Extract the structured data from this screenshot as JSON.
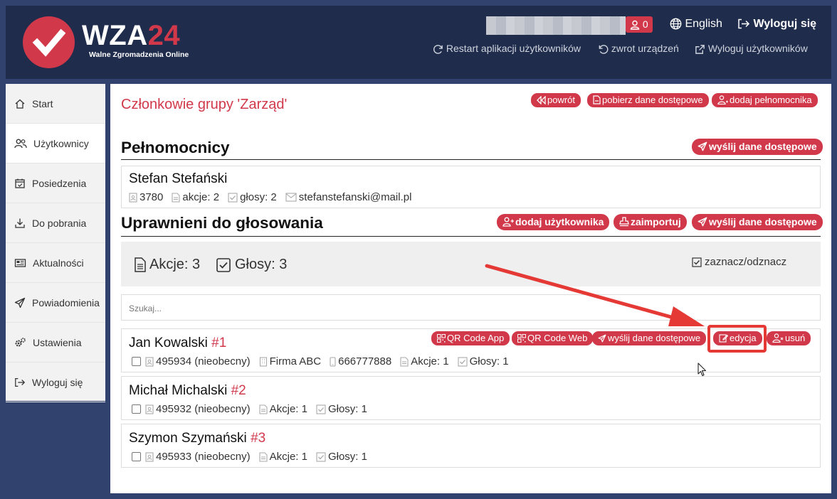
{
  "header": {
    "logo_main": "WZA",
    "logo_num": "24",
    "logo_sub": "Walne Zgromadzenia Online",
    "user_count": "0",
    "language": "English",
    "logout": "Wyloguj się",
    "restart_apps": "Restart aplikacji użytkowników",
    "return_devices": "zwrot urządzeń",
    "logout_users": "Wyloguj użytkowników"
  },
  "sidebar": {
    "items": [
      {
        "label": "Start",
        "icon": "home-icon"
      },
      {
        "label": "Użytkownicy",
        "icon": "users-icon"
      },
      {
        "label": "Posiedzenia",
        "icon": "calendar-icon"
      },
      {
        "label": "Do pobrania",
        "icon": "download-icon"
      },
      {
        "label": "Aktualności",
        "icon": "news-icon"
      },
      {
        "label": "Powiadomienia",
        "icon": "paper-plane-icon"
      },
      {
        "label": "Ustawienia",
        "icon": "gears-icon"
      },
      {
        "label": "Wyloguj się",
        "icon": "sign-out-icon"
      }
    ]
  },
  "main": {
    "title": "Członkowie grupy 'Zarząd'",
    "buttons": {
      "back": "powrót",
      "download_access": "pobierz dane dostępowe",
      "add_proxy": "dodaj pełnomocnika",
      "send_access": "wyślij dane dostępowe",
      "add_user": "dodaj użytkownika",
      "import": "zaimportuj"
    },
    "proxies_title": "Pełnomocnicy",
    "proxy": {
      "name": "Stefan Stefański",
      "id": "3780",
      "shares": "akcje: 2",
      "votes": "głosy: 2",
      "email": "stefanstefanski@mail.pl"
    },
    "voters_title": "Uprawnieni do głosowania",
    "summary": {
      "shares": "Akcje: 3",
      "votes": "Głosy: 3",
      "toggle_all": "zaznacz/odznacz"
    },
    "search_placeholder": "Szukaj...",
    "row_buttons": {
      "qr_app": "QR Code App",
      "qr_web": "QR Code Web",
      "send_access": "wyślij dane dostępowe",
      "edit": "edycja",
      "delete": "usuń"
    },
    "members": [
      {
        "name": "Jan Kowalski",
        "index": "#1",
        "id": "495934 (nieobecny)",
        "company": "Firma ABC",
        "phone": "666777888",
        "shares": "Akcje: 1",
        "votes": "Głosy: 1"
      },
      {
        "name": "Michał Michalski",
        "index": "#2",
        "id": "495932 (nieobecny)",
        "shares": "Akcje: 1",
        "votes": "Głosy: 1"
      },
      {
        "name": "Szymon Szymański",
        "index": "#3",
        "id": "495933 (nieobecny)",
        "shares": "Akcje: 1",
        "votes": "Głosy: 1"
      }
    ]
  },
  "colors": {
    "brand": "#d1394b",
    "header_bg": "#1f2c4c",
    "page_bg": "#32426e",
    "annotation": "#e53935"
  }
}
